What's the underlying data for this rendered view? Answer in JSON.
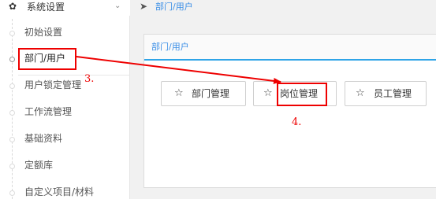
{
  "sidebar": {
    "header": {
      "icon": "gear-icon",
      "title": "系统设置",
      "chevron": "chevron-down-icon"
    },
    "items": [
      {
        "label": "初始设置"
      },
      {
        "label": "部门/用户"
      },
      {
        "label": "用户锁定管理"
      },
      {
        "label": "工作流管理"
      },
      {
        "label": "基础资料"
      },
      {
        "label": "定额库"
      },
      {
        "label": "自定义项目/材料"
      }
    ],
    "active_index": 1
  },
  "breadcrumb": {
    "icon": "send-icon",
    "text": "部门/用户"
  },
  "panel": {
    "title": "部门/用户",
    "buttons": [
      {
        "icon": "star-icon",
        "label": "部门管理"
      },
      {
        "icon": "star-icon",
        "label": "岗位管理"
      },
      {
        "icon": "star-icon",
        "label": "员工管理"
      }
    ]
  },
  "annotations": {
    "step3": "3.",
    "step4": "4."
  },
  "colors": {
    "highlight": "#ee0000",
    "accent": "#2fa4e7",
    "link": "#3a8ee6"
  }
}
